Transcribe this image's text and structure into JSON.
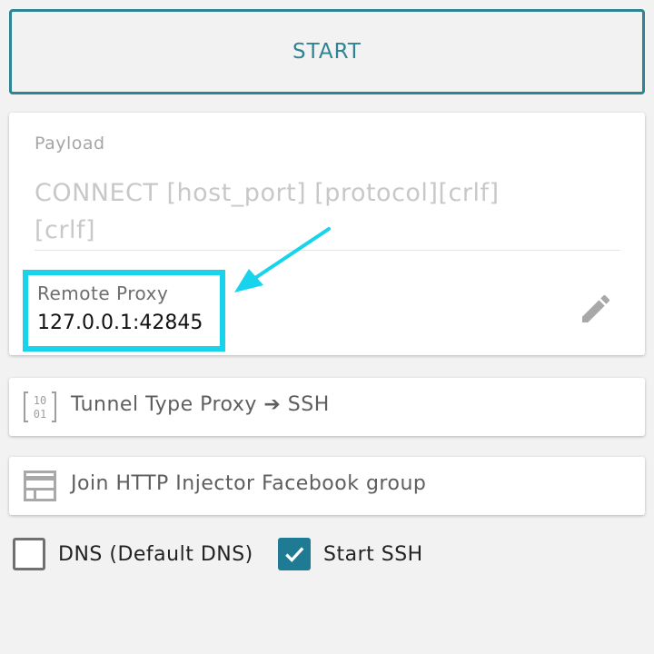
{
  "start_button": {
    "label": "START"
  },
  "payload": {
    "label": "Payload",
    "value_line1": "CONNECT [host_port] [protocol][crlf]",
    "value_line2": "[crlf]"
  },
  "remote_proxy": {
    "label": "Remote Proxy",
    "value": "127.0.0.1:42845"
  },
  "tunnel_type": {
    "icon": "binary-icon",
    "label": "Tunnel Type Proxy ➔ SSH"
  },
  "join_group": {
    "icon": "facebook-group-icon",
    "label": "Join HTTP Injector Facebook group"
  },
  "options": {
    "dns": {
      "label": "DNS (Default DNS)",
      "checked": false
    },
    "start_ssh": {
      "label": "Start SSH",
      "checked": true
    }
  },
  "colors": {
    "accent": "#2e8493",
    "checkbox_checked": "#1e7b93",
    "highlight": "#17d4ec"
  }
}
